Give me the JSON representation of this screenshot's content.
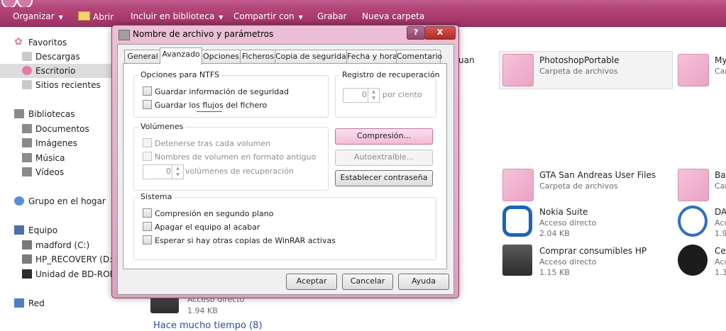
{
  "explorer": {
    "toolbar": {
      "organize": "Organizar",
      "open": "Abrir",
      "include_library": "Incluir en biblioteca",
      "share_with": "Compartir con",
      "burn": "Grabar",
      "new_folder": "Nueva carpeta"
    },
    "nav": {
      "favorites": "Favoritos",
      "downloads": "Descargas",
      "desktop": "Escritorio",
      "recent": "Sitios recientes",
      "libraries": "Bibliotecas",
      "documents": "Documentos",
      "pictures": "Imágenes",
      "music": "Música",
      "videos": "Vídeos",
      "homegroup": "Grupo en el hogar",
      "computer": "Equipo",
      "drive_c": "madford (C:)",
      "drive_d": "HP_RECOVERY (D:)",
      "drive_bd": "Unidad de BD-ROM (",
      "network": "Red"
    },
    "files": [
      {
        "name": "PhotoshopPortable",
        "type": "Carpeta de archivos",
        "size": ""
      },
      {
        "name": "My",
        "type": "Car",
        "size": ""
      },
      {
        "name": "uan",
        "type": "",
        "size": ""
      },
      {
        "name": "GTA San Andreas User Files",
        "type": "Carpeta de archivos",
        "size": ""
      },
      {
        "name": "Bac",
        "type": "Car",
        "size": ""
      },
      {
        "name": "Nokia Suite",
        "type": "Acceso directo",
        "size": "2.04 KB"
      },
      {
        "name": "DA",
        "type": "Acc",
        "size": "1.90"
      },
      {
        "name": "Comprar consumibles HP",
        "type": "Acceso directo",
        "size": "1.15 KB"
      },
      {
        "name": "Cer",
        "type": "Acc",
        "size": "1.33"
      },
      {
        "name": "",
        "type": "Acceso directo",
        "size": "1.94 KB"
      }
    ],
    "footer_group": "Hace mucho tiempo (8)"
  },
  "dialog": {
    "title": "Nombre de archivo y parámetros",
    "help_glyph": "?",
    "close_glyph": "X",
    "tabs": [
      "General",
      "Avanzado",
      "Opciones",
      "Ficheros",
      "Copia de seguridad",
      "Fecha y hora",
      "Comentario"
    ],
    "active_tab": "Avanzado",
    "ntfs": {
      "label": "Opciones para NTFS",
      "save_security": "Guardar información de seguridad",
      "save_streams": "Guardar los flujos del fichero"
    },
    "recovery": {
      "label": "Registro de recuperación",
      "value": "0",
      "unit": "por ciento"
    },
    "volumes": {
      "label": "Volúmenes",
      "stop_after": "Detenerse tras cada volumen",
      "old_naming": "Nombres de volumen en formato antiguo",
      "recovery_count": "0",
      "recovery_label": "volúmenes de recuperación"
    },
    "buttons": {
      "compression": "Compresión...",
      "sfx": "Autoextraíble...",
      "password": "Establecer contraseña",
      "ok": "Aceptar",
      "cancel": "Cancelar",
      "help": "Ayuda"
    },
    "system": {
      "label": "Sistema",
      "background": "Compresión en segundo plano",
      "shutdown": "Apagar el equipo al acabar",
      "wait": "Esperar si hay otras copias de WinRAR activas"
    }
  },
  "colors": {
    "accent": "#b8457a",
    "dialog_frame": "#e3aac7",
    "hot_button": "#f3b9d6"
  }
}
